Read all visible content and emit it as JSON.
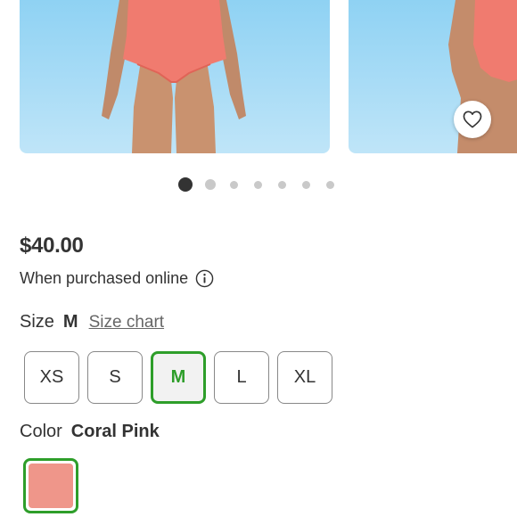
{
  "gallery": {
    "image_count": 7,
    "active_index": 0
  },
  "product": {
    "price": "$40.00",
    "purchase_note": "When purchased online"
  },
  "size": {
    "label": "Size",
    "selected": "M",
    "chart_link": "Size chart",
    "options": [
      "XS",
      "S",
      "M",
      "L",
      "XL"
    ]
  },
  "color": {
    "label": "Color",
    "selected": "Coral Pink",
    "swatch_hex": "#ef968a"
  },
  "icons": {
    "favorite": "heart-icon",
    "info": "info-icon"
  },
  "colors": {
    "accent": "#2e9e2a",
    "text": "#333333",
    "swimsuit": "#f07b6f"
  }
}
